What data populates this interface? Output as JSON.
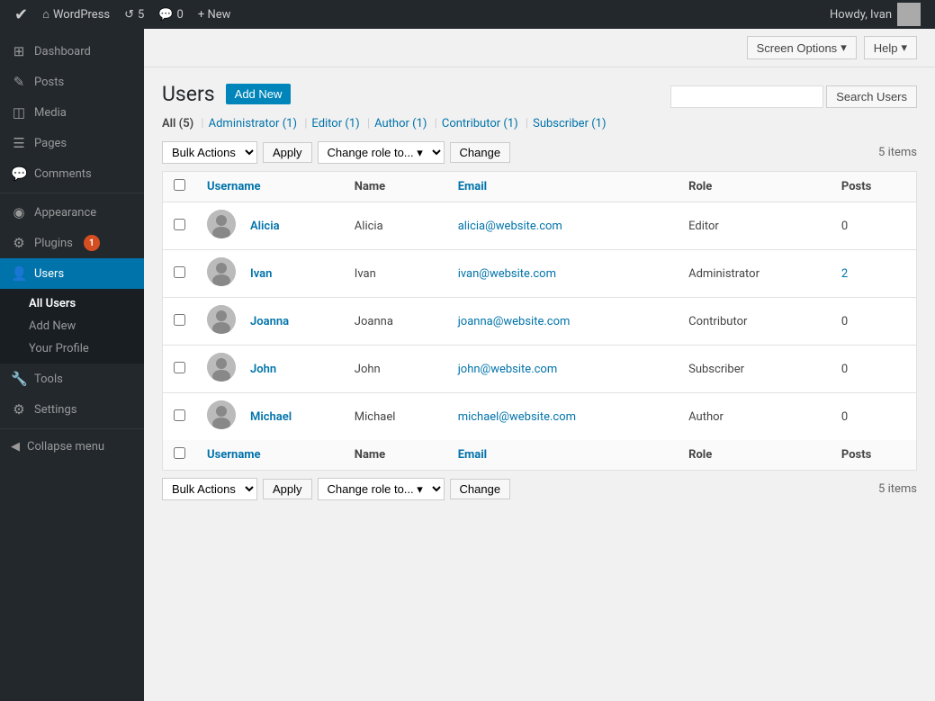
{
  "adminbar": {
    "logo": "W",
    "items": [
      {
        "label": "WordPress",
        "icon": "home"
      },
      {
        "label": "5",
        "icon": "refresh"
      },
      {
        "label": "0",
        "icon": "comment"
      },
      {
        "label": "+ New",
        "icon": "plus"
      }
    ],
    "right": {
      "howdy": "Howdy, Ivan"
    }
  },
  "topbar": {
    "screen_options": "Screen Options",
    "help": "Help"
  },
  "sidebar": {
    "items": [
      {
        "label": "Dashboard",
        "icon": "⊞",
        "id": "dashboard"
      },
      {
        "label": "Posts",
        "icon": "✎",
        "id": "posts"
      },
      {
        "label": "Media",
        "icon": "◫",
        "id": "media"
      },
      {
        "label": "Pages",
        "icon": "☰",
        "id": "pages"
      },
      {
        "label": "Comments",
        "icon": "💬",
        "id": "comments"
      },
      {
        "label": "Appearance",
        "icon": "◉",
        "id": "appearance"
      },
      {
        "label": "Plugins",
        "icon": "⚙",
        "id": "plugins",
        "badge": "1"
      },
      {
        "label": "Users",
        "icon": "👤",
        "id": "users",
        "active": true
      },
      {
        "label": "Tools",
        "icon": "🔧",
        "id": "tools"
      },
      {
        "label": "Settings",
        "icon": "⚙",
        "id": "settings"
      }
    ],
    "submenu_users": [
      {
        "label": "All Users",
        "id": "all-users",
        "active": true
      },
      {
        "label": "Add New",
        "id": "add-new"
      },
      {
        "label": "Your Profile",
        "id": "your-profile"
      }
    ],
    "collapse_label": "Collapse menu"
  },
  "page": {
    "title": "Users",
    "add_new_label": "Add New",
    "filter_links": [
      {
        "label": "All",
        "count": "(5)",
        "id": "all",
        "current": true
      },
      {
        "label": "Administrator",
        "count": "(1)",
        "id": "administrator"
      },
      {
        "label": "Editor",
        "count": "(1)",
        "id": "editor"
      },
      {
        "label": "Author",
        "count": "(1)",
        "id": "author"
      },
      {
        "label": "Contributor",
        "count": "(1)",
        "id": "contributor"
      },
      {
        "label": "Subscriber",
        "count": "(1)",
        "id": "subscriber"
      }
    ],
    "search_placeholder": "",
    "search_button": "Search Users",
    "items_count": "5 items",
    "bulk_actions_label": "Bulk Actions",
    "apply_label": "Apply",
    "change_role_label": "Change role to...",
    "change_label": "Change",
    "columns": [
      {
        "label": "Username",
        "id": "username"
      },
      {
        "label": "Name",
        "id": "name"
      },
      {
        "label": "Email",
        "id": "email"
      },
      {
        "label": "Role",
        "id": "role"
      },
      {
        "label": "Posts",
        "id": "posts"
      }
    ],
    "users": [
      {
        "username": "Alicia",
        "name": "Alicia",
        "email": "alicia@website.com",
        "role": "Editor",
        "posts": "0",
        "posts_is_link": false
      },
      {
        "username": "Ivan",
        "name": "Ivan",
        "email": "ivan@website.com",
        "role": "Administrator",
        "posts": "2",
        "posts_is_link": true
      },
      {
        "username": "Joanna",
        "name": "Joanna",
        "email": "joanna@website.com",
        "role": "Contributor",
        "posts": "0",
        "posts_is_link": false
      },
      {
        "username": "John",
        "name": "John",
        "email": "john@website.com",
        "role": "Subscriber",
        "posts": "0",
        "posts_is_link": false
      },
      {
        "username": "Michael",
        "name": "Michael",
        "email": "michael@website.com",
        "role": "Author",
        "posts": "0",
        "posts_is_link": false
      }
    ]
  }
}
